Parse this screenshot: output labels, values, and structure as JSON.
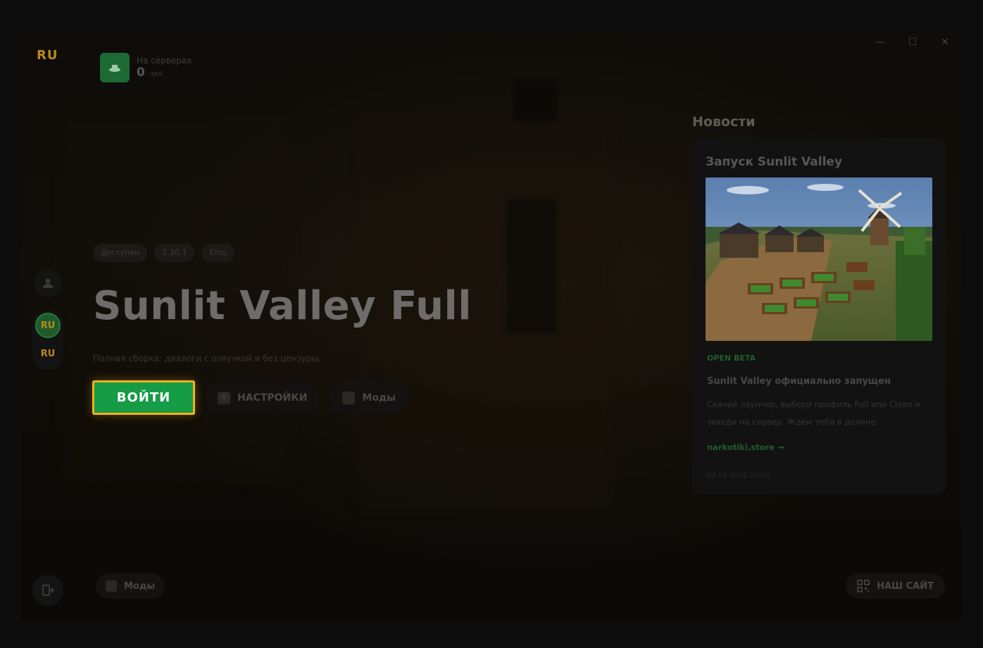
{
  "window": {
    "logo": "RU",
    "controls": {
      "minimize": "—",
      "maximize": "☐",
      "close": "✕"
    }
  },
  "online": {
    "label": "На серверах",
    "count": "0",
    "unit": "чел."
  },
  "sidebar": {
    "server_1": "RU",
    "server_2": "RU"
  },
  "server": {
    "tags": [
      "Доступен",
      "1.20.1",
      "Emu"
    ],
    "title": "Sunlit Valley Full",
    "subtitle": "Полная сборка: диалоги с озвучкой и без цензуры.",
    "play_label": "ВОЙТИ",
    "settings_label": "НАСТРОЙКИ",
    "mods_label": "Моды"
  },
  "bottom": {
    "mods_label": "Моды",
    "site_label": "НАШ САЙТ"
  },
  "news": {
    "heading": "Новости",
    "card": {
      "title": "Запуск Sunlit Valley",
      "badge": "OPEN BETA",
      "headline": "Sunlit Valley официально запущен",
      "body": "Скачай лаунчер, выбери профиль Full или Clean и заходи на сервер. Ждём тебя в долине.",
      "link": "narkotiki.store →",
      "date": "06.09.2026 20:00"
    }
  },
  "colors": {
    "accent_green": "#169b47",
    "focus_gold": "#f1b317",
    "logo_gold": "#b88a1c"
  }
}
